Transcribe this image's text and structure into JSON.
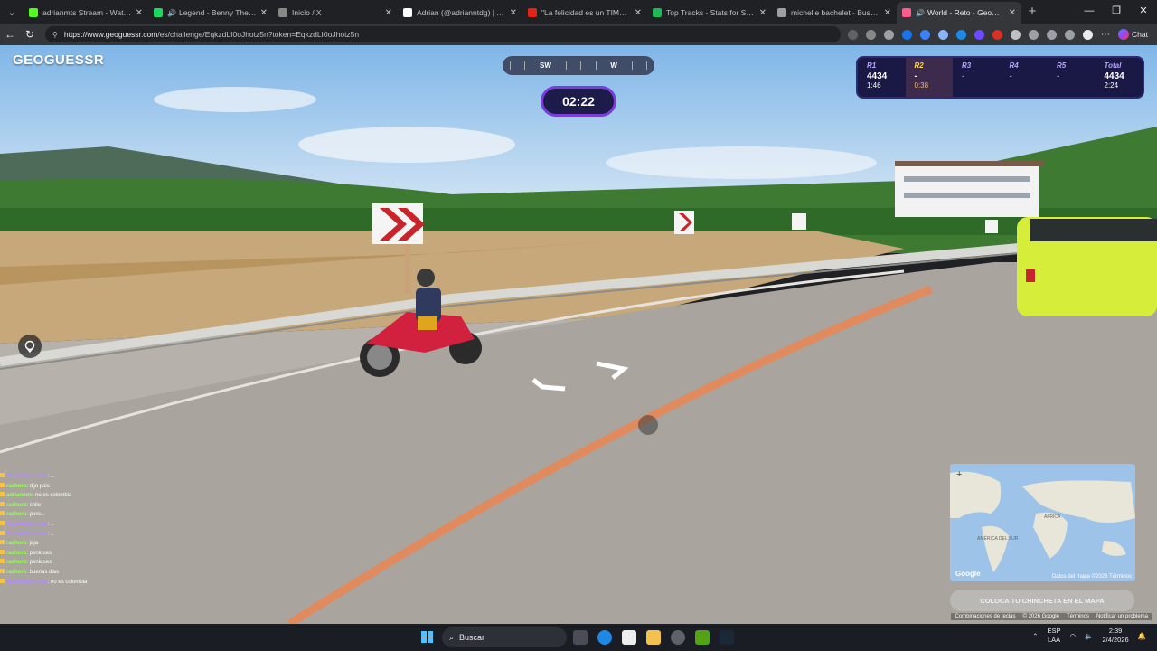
{
  "browser": {
    "tabs": [
      {
        "title": "adrianmts Stream - Watch Live",
        "favicon_color": "#53fc18",
        "active": false
      },
      {
        "title": "Legend - Benny The Butch",
        "favicon_color": "#1ed760",
        "active": false,
        "audio": true
      },
      {
        "title": "Inicio / X",
        "favicon_color": "#888888",
        "active": false
      },
      {
        "title": "Adrian (@adrianntdg) | TikTok",
        "favicon_color": "#ffffff",
        "active": false
      },
      {
        "title": "\"La felicidad es un TIMO\", AM",
        "favicon_color": "#e62117",
        "active": false
      },
      {
        "title": "Top Tracks - Stats for Spotify",
        "favicon_color": "#1db954",
        "active": false
      },
      {
        "title": "michelle bachelet - Buscar con",
        "favicon_color": "#9aa0a6",
        "active": false
      },
      {
        "title": "World - Reto - GeoGuessr",
        "favicon_color": "#ff5a8a",
        "active": true,
        "audio": true
      }
    ],
    "new_tab": "+",
    "window_controls": [
      "—",
      "❐",
      "✕"
    ],
    "url_host": "https://www.geoguessr.com",
    "url_path": "/es/challenge/EqkzdLI0oJhotz5n?token=EqkzdLI0oJhotz5n",
    "chat_label": "Chat"
  },
  "game": {
    "logo": "GEOGUESSR",
    "compass": {
      "left": "SW",
      "right": "W"
    },
    "timer": "02:22",
    "rounds": [
      {
        "label": "R1",
        "score": "4434",
        "time": "1:46",
        "state": "done"
      },
      {
        "label": "R2",
        "score": "-",
        "time": "0:38",
        "state": "current"
      },
      {
        "label": "R3",
        "score": "-",
        "time": "",
        "state": "pending"
      },
      {
        "label": "R4",
        "score": "-",
        "time": "",
        "state": "pending"
      },
      {
        "label": "R5",
        "score": "-",
        "time": "",
        "state": "pending"
      },
      {
        "label": "Total",
        "score": "4434",
        "time": "2:24",
        "state": "total"
      }
    ],
    "guess_button": "COLOCA TU CHINCHETA EN EL MAPA",
    "minimap": {
      "zoom": "+",
      "google": "Google",
      "footer": "Datos del mapa ©2026   Términos",
      "labels": [
        "AMÉRICA DEL SUR",
        "ÁFRICA"
      ]
    },
    "attribution": [
      "Combinaciones de teclas",
      "© 2026 Google",
      "Términos",
      "Notificar un problema"
    ]
  },
  "chat": [
    {
      "user": "NachoCrispetas",
      "msg": "...",
      "purple": true
    },
    {
      "user": "rashoro",
      "msg": "dijo pais"
    },
    {
      "user": "adrianmts",
      "msg": "no es colombia"
    },
    {
      "user": "rashoro",
      "msg": "chile"
    },
    {
      "user": "rashoro",
      "msg": "pero..."
    },
    {
      "user": "NachoCrispetas",
      "msg": "..",
      "purple": true
    },
    {
      "user": "NachoCrispetas",
      "msg": "..",
      "purple": true
    },
    {
      "user": "rashoro",
      "msg": "jaja"
    },
    {
      "user": "rashoro",
      "msg": "peniques"
    },
    {
      "user": "rashoro",
      "msg": "peniques"
    },
    {
      "user": "rashoro",
      "msg": "buenas dias"
    },
    {
      "user": "NachoCrispetas",
      "msg": "no es colombia",
      "purple": true
    }
  ],
  "taskbar": {
    "search_label": "Buscar",
    "lang": "ESP",
    "lang2": "LAA",
    "time": "2:39",
    "date": "2/4/2026"
  }
}
